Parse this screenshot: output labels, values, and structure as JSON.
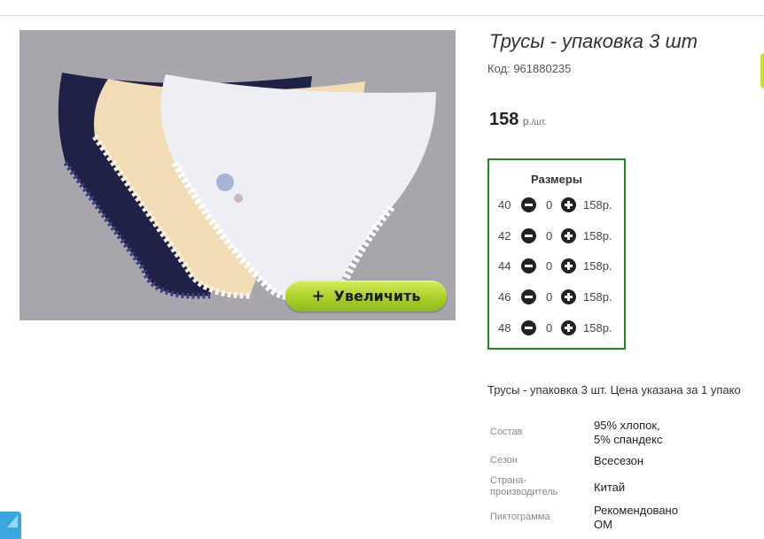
{
  "product": {
    "title": "Трусы - упаковка 3 шт",
    "code": "Код: 961880235",
    "price": "158",
    "price_unit": "р.",
    "price_per": "/шт.",
    "zoom_button_label": "Увеличить",
    "zoom_button_icon": "+",
    "description": "Трусы - упаковка 3 шт. Цена указана за 1 упако"
  },
  "sizes": {
    "title": "Размеры",
    "rows": [
      {
        "size": "40",
        "qty": "0",
        "price": "158р."
      },
      {
        "size": "42",
        "qty": "0",
        "price": "158р."
      },
      {
        "size": "44",
        "qty": "0",
        "price": "158р."
      },
      {
        "size": "46",
        "qty": "0",
        "price": "158р."
      },
      {
        "size": "48",
        "qty": "0",
        "price": "158р."
      }
    ]
  },
  "attributes": [
    {
      "label": "Состав",
      "value_lines": [
        "95% хлопок,",
        "5% спандекс"
      ]
    },
    {
      "label": "Сезон",
      "value_lines": [
        "Всесезон"
      ]
    },
    {
      "label_lines": [
        "Страна-",
        "производитель"
      ],
      "value_lines": [
        "Китай"
      ]
    },
    {
      "label": "Пиктограмма",
      "value_lines": [
        "Рекомендовано",
        "ОМ"
      ]
    }
  ],
  "colors": {
    "sizes_border": "#1a8a1a",
    "zoom_button": "#a9cf2a",
    "photo_background": "#a9a5ad"
  }
}
